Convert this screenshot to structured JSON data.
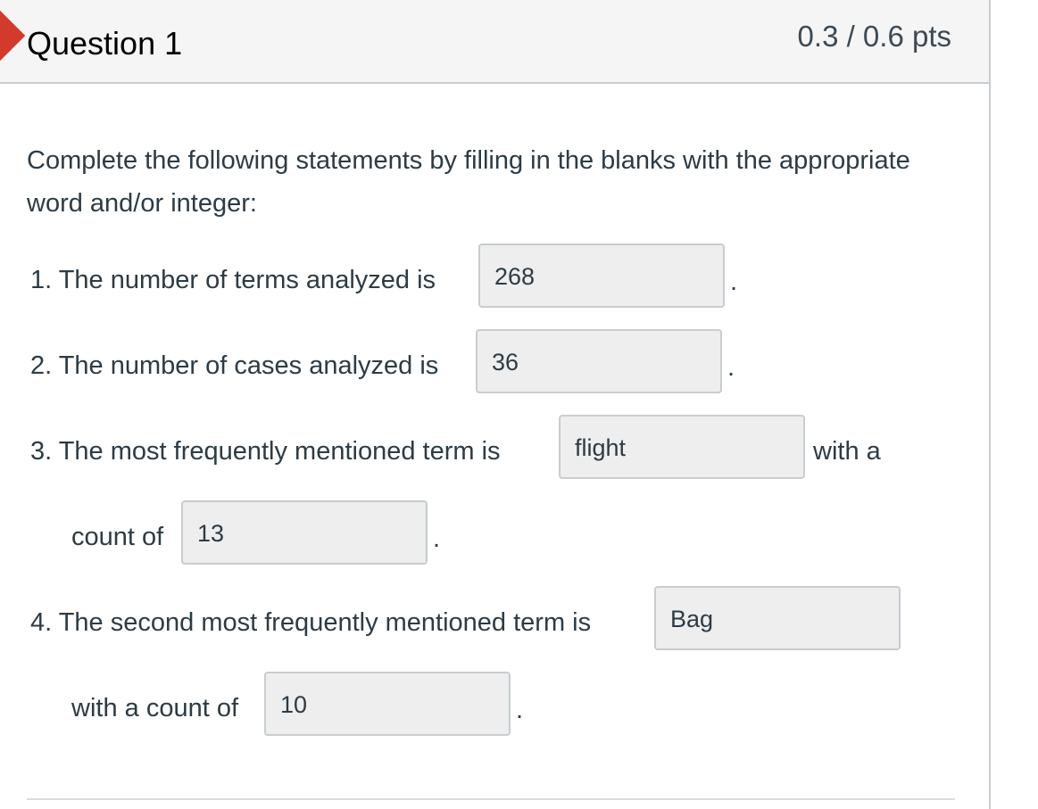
{
  "question": {
    "title": "Question 1",
    "points": "0.3 / 0.6 pts"
  },
  "instructions": "Complete the following statements by filling in the blanks with the appropriate word and/or integer:",
  "items": [
    {
      "text": "1. The number of terms analyzed is",
      "answer": "268",
      "suffix": "."
    },
    {
      "text": "2. The number of cases analyzed is",
      "answer": "36",
      "suffix": "."
    },
    {
      "text": "3. The most frequently mentioned term is",
      "answer": "flight",
      "suffix": "with a",
      "text2": "count of",
      "answer2": "13",
      "suffix2": "."
    },
    {
      "text": "4. The second most frequently mentioned term is",
      "answer": "Bag",
      "text2": "with a count of",
      "answer2": "10",
      "suffix2": "."
    }
  ],
  "colors": {
    "flag": "#d23a2c",
    "header_bg": "#f5f5f5",
    "box_bg": "#eeeeee",
    "border": "#c7cdd1"
  }
}
